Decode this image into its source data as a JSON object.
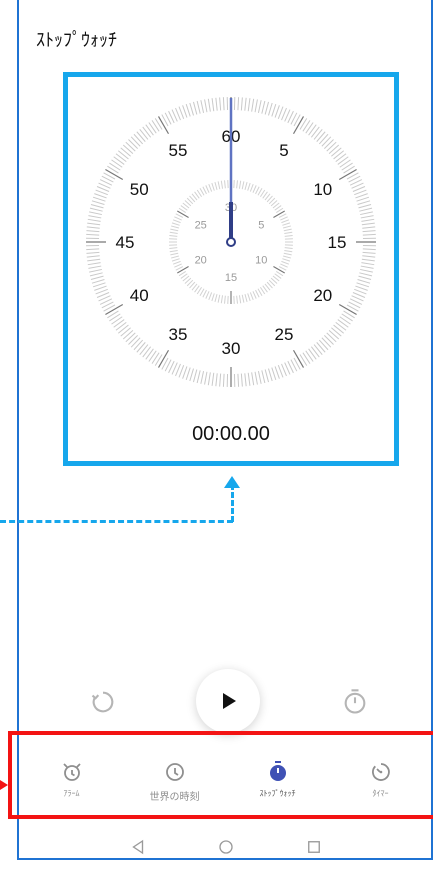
{
  "header": {
    "title": "ｽﾄｯﾌﾟｳｫｯﾁ"
  },
  "stopwatch": {
    "elapsed": "00:00.00",
    "outer_labels": [
      "60",
      "5",
      "10",
      "15",
      "20",
      "25",
      "30",
      "35",
      "40",
      "45",
      "50",
      "55"
    ],
    "inner_labels": [
      "30",
      "5",
      "10",
      "15",
      "20",
      "25"
    ]
  },
  "controls": {
    "reset_icon": "refresh-icon",
    "play_icon": "play-icon",
    "lap_icon": "stopwatch-icon"
  },
  "tabs": [
    {
      "label": "ｱﾗｰﾑ",
      "icon": "alarm-clock-icon",
      "active": false
    },
    {
      "label": "世界の時刻",
      "icon": "clock-icon",
      "active": false
    },
    {
      "label": "ｽﾄｯﾌﾟｳｫｯﾁ",
      "icon": "stopwatch-icon",
      "active": true
    },
    {
      "label": "ﾀｲﾏｰ",
      "icon": "timer-icon",
      "active": false
    }
  ],
  "system_nav": {
    "back_icon": "back-triangle-icon",
    "home_icon": "home-circle-icon",
    "recent_icon": "recent-square-icon"
  },
  "colors": {
    "accent": "#3f51b5",
    "cyan_annotation": "#16a7ec",
    "red_annotation": "#f31313",
    "frame_blue": "#1f73d3"
  }
}
